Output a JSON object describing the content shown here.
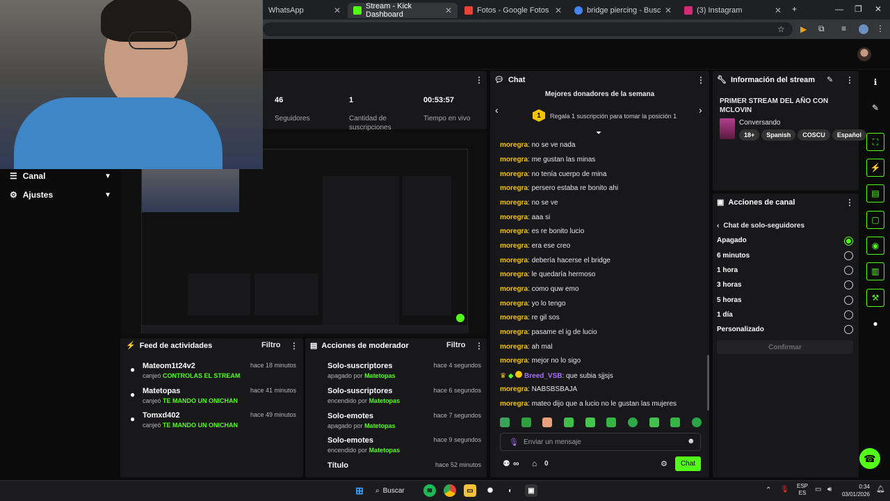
{
  "browser": {
    "tabs": [
      {
        "title": "WhatsApp",
        "favicon": "#25d366"
      },
      {
        "title": "Stream - Kick Dashboard",
        "favicon": "#53fc18"
      },
      {
        "title": "Fotos - Google Fotos",
        "favicon": "#ea4335"
      },
      {
        "title": "bridge piercing - Buscar con Go",
        "favicon": "#4285f4"
      },
      {
        "title": "(3) Instagram",
        "favicon": "#d62976"
      }
    ]
  },
  "stats": [
    {
      "value": "46",
      "label": "Seguidores"
    },
    {
      "value": "1",
      "label": "Cantidad de suscripciones"
    },
    {
      "value": "00:53:57",
      "label": "Tiempo en vivo"
    }
  ],
  "sidebar": {
    "items": [
      {
        "label": "Canal"
      },
      {
        "label": "Ajustes"
      }
    ]
  },
  "activity": {
    "title": "Feed de actividades",
    "filter": "Filtro",
    "items": [
      {
        "user": "Mateom1t24v2",
        "time": "hace 18 minutos",
        "action": "canjeó",
        "reward": "CONTROLAS EL STREAM"
      },
      {
        "user": "Matetopas",
        "time": "hace 41 minutos",
        "action": "canjeó",
        "reward": "TE MANDO UN ONICHAN"
      },
      {
        "user": "Tomxd402",
        "time": "hace 49 minutos",
        "action": "canjeó",
        "reward": "TE MANDO UN ONICHAN"
      }
    ]
  },
  "modactions": {
    "title": "Acciones de moderador",
    "filter": "Filtro",
    "items": [
      {
        "title": "Solo-suscriptores",
        "time": "hace 4 segundos",
        "state": "apagado por",
        "by": "Matetopas"
      },
      {
        "title": "Solo-suscriptores",
        "time": "hace 6 segundos",
        "state": "encendido por",
        "by": "Matetopas"
      },
      {
        "title": "Solo-emotes",
        "time": "hace 7 segundos",
        "state": "apagado por",
        "by": "Matetopas"
      },
      {
        "title": "Solo-emotes",
        "time": "hace 9 segundos",
        "state": "encendido por",
        "by": "Matetopas"
      },
      {
        "title": "Título",
        "time": "hace 52 minutos",
        "state": "",
        "by": ""
      }
    ]
  },
  "chat": {
    "title": "Chat",
    "donors_title": "Mejores donadores de la semana",
    "donors_cta": "Regala 1 suscripción para tomar la posición 1",
    "rank": "1",
    "messages": [
      {
        "user": "moregra",
        "text": "no se ve nada"
      },
      {
        "user": "moregra",
        "text": "me gustan las minas"
      },
      {
        "user": "moregra",
        "text": "no tenía cuerpo de mina"
      },
      {
        "user": "moregra",
        "text": "persero estaba re bonito ahi"
      },
      {
        "user": "moregra",
        "text": "no se ve"
      },
      {
        "user": "moregra",
        "text": "aaa si"
      },
      {
        "user": "moregra",
        "text": "es re bonito lucio"
      },
      {
        "user": "moregra",
        "text": "era ese creo"
      },
      {
        "user": "moregra",
        "text": "debería hacerse el bridge"
      },
      {
        "user": "moregra",
        "text": "le quedaría hermoso"
      },
      {
        "user": "moregra",
        "text": "como quw emo"
      },
      {
        "user": "moregra",
        "text": "yo lo tengo"
      },
      {
        "user": "moregra",
        "text": "re gil sos"
      },
      {
        "user": "moregra",
        "text": "pasame el ig de lucio"
      },
      {
        "user": "moregra",
        "text": "ah mal"
      },
      {
        "user": "moregra",
        "text": "mejor no lo sigo"
      },
      {
        "user": "Breed_VSB",
        "text": "que subia sjjsjs"
      },
      {
        "user": "moregra",
        "text": "NABSBSBAJA"
      },
      {
        "user": "moregra",
        "text": "mateo dijo que a lucio no le gustan las mujeres"
      }
    ],
    "placeholder": "Enviar un mensaje",
    "points": "∞",
    "count": "0",
    "send": "Chat"
  },
  "stream_info": {
    "title": "Información del stream",
    "stream_title": "PRIMER STREAM DEL AÑO CON MCLOVIN",
    "category": "Conversando",
    "tags": [
      "18+",
      "Spanish",
      "COSCU",
      "Español"
    ]
  },
  "channel_actions": {
    "title": "Acciones de canal",
    "subtitle": "Chat de solo-seguidores",
    "options": [
      {
        "label": "Apagado",
        "selected": true
      },
      {
        "label": "6 minutos",
        "selected": false
      },
      {
        "label": "1 hora",
        "selected": false
      },
      {
        "label": "3 horas",
        "selected": false
      },
      {
        "label": "5 horas",
        "selected": false
      },
      {
        "label": "1 día",
        "selected": false
      },
      {
        "label": "Personalizado",
        "selected": false
      }
    ],
    "confirm": "Confirmar"
  },
  "taskbar": {
    "search": "Buscar",
    "lang": "ESP",
    "lang2": "ES",
    "time": "0:34",
    "date": "03/01/2026"
  },
  "colors": {
    "accent": "#53fc18",
    "username": "#f5c400"
  }
}
